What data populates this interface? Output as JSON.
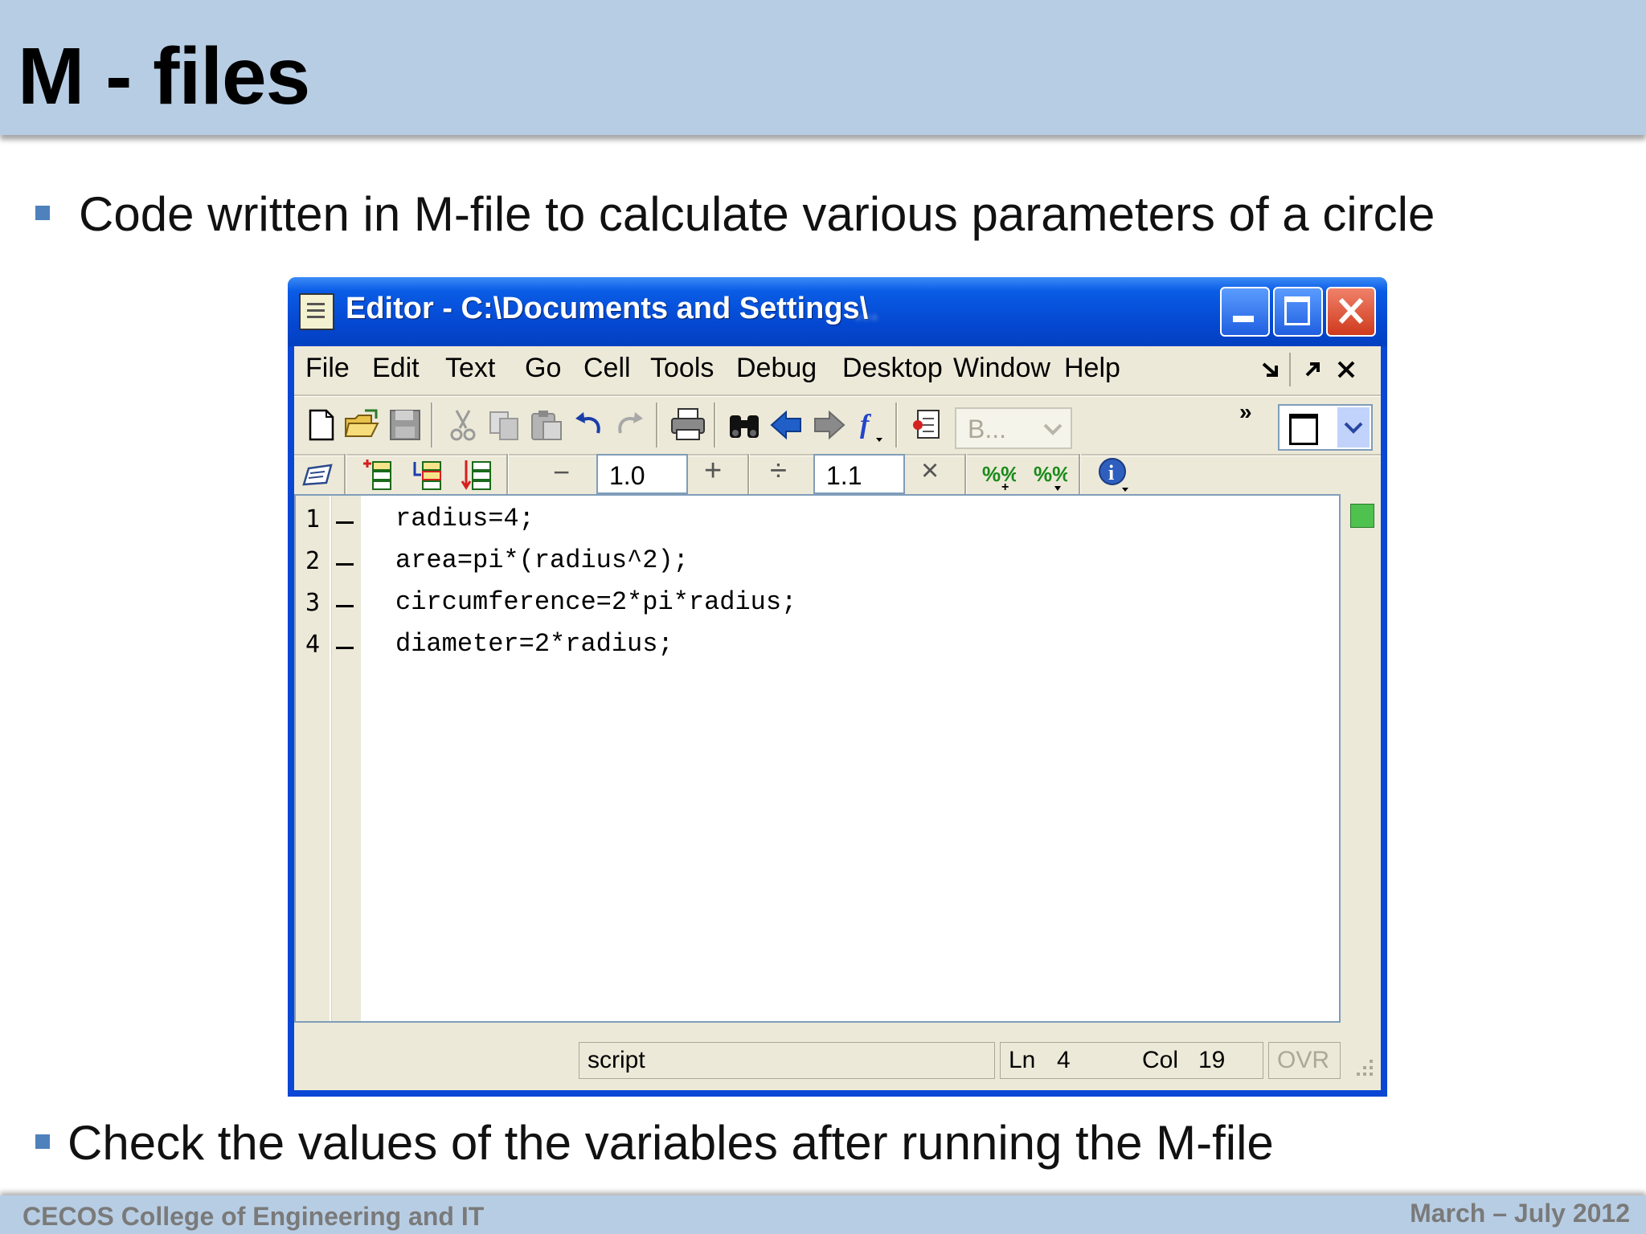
{
  "slide": {
    "title": "M - files",
    "bullet1": "Code written in M-file to calculate various parameters of a circle",
    "bullet2": "Check the values of the variables after running the M-file",
    "footer_left": "CECOS College of Engineering and IT",
    "footer_right": "March – July 2012"
  },
  "window": {
    "title": "Editor - C:\\Documents and Settings\\",
    "title_obscured": "...",
    "controls": [
      "minimize",
      "maximize",
      "close"
    ]
  },
  "menu": {
    "items": [
      "File",
      "Edit",
      "Text",
      "Go",
      "Cell",
      "Tools",
      "Debug",
      "Desktop",
      "Window",
      "Help"
    ]
  },
  "toolbar1": {
    "icons": [
      "new-file-icon",
      "open-folder-icon",
      "save-icon",
      "cut-icon",
      "copy-icon",
      "paste-icon",
      "undo-icon",
      "redo-icon",
      "print-icon",
      "find-icon",
      "back-icon",
      "forward-icon",
      "function-icon",
      "debug-stack-icon"
    ],
    "stack_select": "B...",
    "overflow": "»"
  },
  "toolbar2": {
    "minus": "−",
    "value1": "1.0",
    "plus": "+",
    "divide": "÷",
    "value2": "1.1",
    "times": "×"
  },
  "editor": {
    "lines": [
      {
        "num": "1",
        "code": "radius=4;"
      },
      {
        "num": "2",
        "code": "area=pi*(radius^2);"
      },
      {
        "num": "3",
        "code": "circumference=2*pi*radius;"
      },
      {
        "num": "4",
        "code": "diameter=2*radius;"
      }
    ]
  },
  "status": {
    "mode": "script",
    "ln_label": "Ln",
    "ln_value": "4",
    "col_label": "Col",
    "col_value": "19",
    "ovr": "OVR"
  }
}
